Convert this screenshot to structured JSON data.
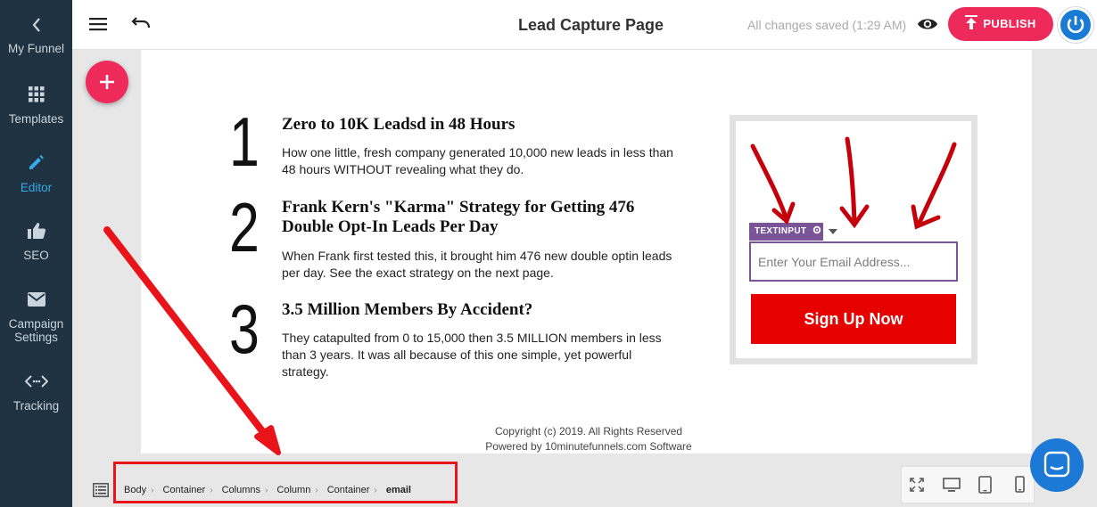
{
  "sidebar": {
    "items": [
      {
        "label": "My Funnel",
        "icon": "chevron-left-icon"
      },
      {
        "label": "Templates",
        "icon": "grid-icon"
      },
      {
        "label": "Editor",
        "icon": "pencil-icon"
      },
      {
        "label": "SEO",
        "icon": "thumbs-up-icon"
      },
      {
        "label": "Campaign Settings",
        "icon": "mail-icon"
      },
      {
        "label": "Tracking",
        "icon": "code-icon"
      }
    ],
    "active_color": "#37a9e6"
  },
  "topbar": {
    "title": "Lead Capture Page",
    "saved_status": "All changes saved (1:29 AM)",
    "publish_label": "PUBLISH"
  },
  "content": {
    "items": [
      {
        "number": "1",
        "heading": "Zero to 10K Leadsd in 48 Hours",
        "text": "How one little, fresh company generated 10,000 new leads in less than 48 hours WITHOUT revealing what they do."
      },
      {
        "number": "2",
        "heading": "Frank Kern's \"Karma\" Strategy for Getting 476 Double Opt-In Leads Per Day",
        "text": "When Frank first tested this, it brought him 476 new double optin leads per day.  See the exact strategy on the next page."
      },
      {
        "number": "3",
        "heading": "3.5 Million Members By Accident?",
        "text": "They catapulted from 0 to 15,000 then 3.5 MILLION members in less than 3 years.  It was all because of this one simple, yet powerful strategy."
      }
    ],
    "footer_line1": "Copyright (c) 2019.  All Rights Reserved",
    "footer_line2": "Powered by 10minutefunnels.com Software"
  },
  "form": {
    "element_tag": "TEXTINPUT",
    "email_placeholder": "Enter Your Email Address...",
    "email_value": "",
    "signup_label": "Sign Up Now",
    "button_color": "#e60000"
  },
  "breadcrumb": [
    "Body",
    "Container",
    "Columns",
    "Column",
    "Container",
    "email"
  ],
  "colors": {
    "accent": "#ee2a5a",
    "sidebar_bg": "#1e3242",
    "annotation_red": "#e8141a"
  }
}
